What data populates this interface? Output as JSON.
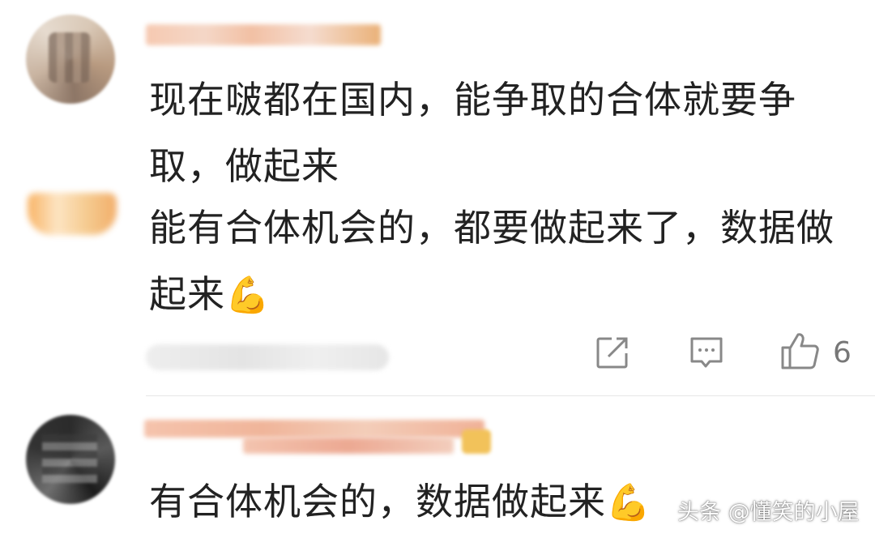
{
  "comments": [
    {
      "text_line1": "现在啵都在国内，能争取的合体就要争取，做起来",
      "text_line2": "能有合体机会的，都要做起来了，数据做起来",
      "emoji": "💪",
      "actions": {
        "share_icon": "share-icon",
        "reply_icon": "comment-icon",
        "like_icon": "thumbs-up-icon",
        "like_count": "6"
      }
    },
    {
      "text": "有合体机会的，数据做起来",
      "emoji": "💪"
    }
  ],
  "watermark": "头条 @懂笑的小屋",
  "colors": {
    "text": "#222222",
    "icon": "#888888",
    "divider": "#e6e6e6"
  }
}
